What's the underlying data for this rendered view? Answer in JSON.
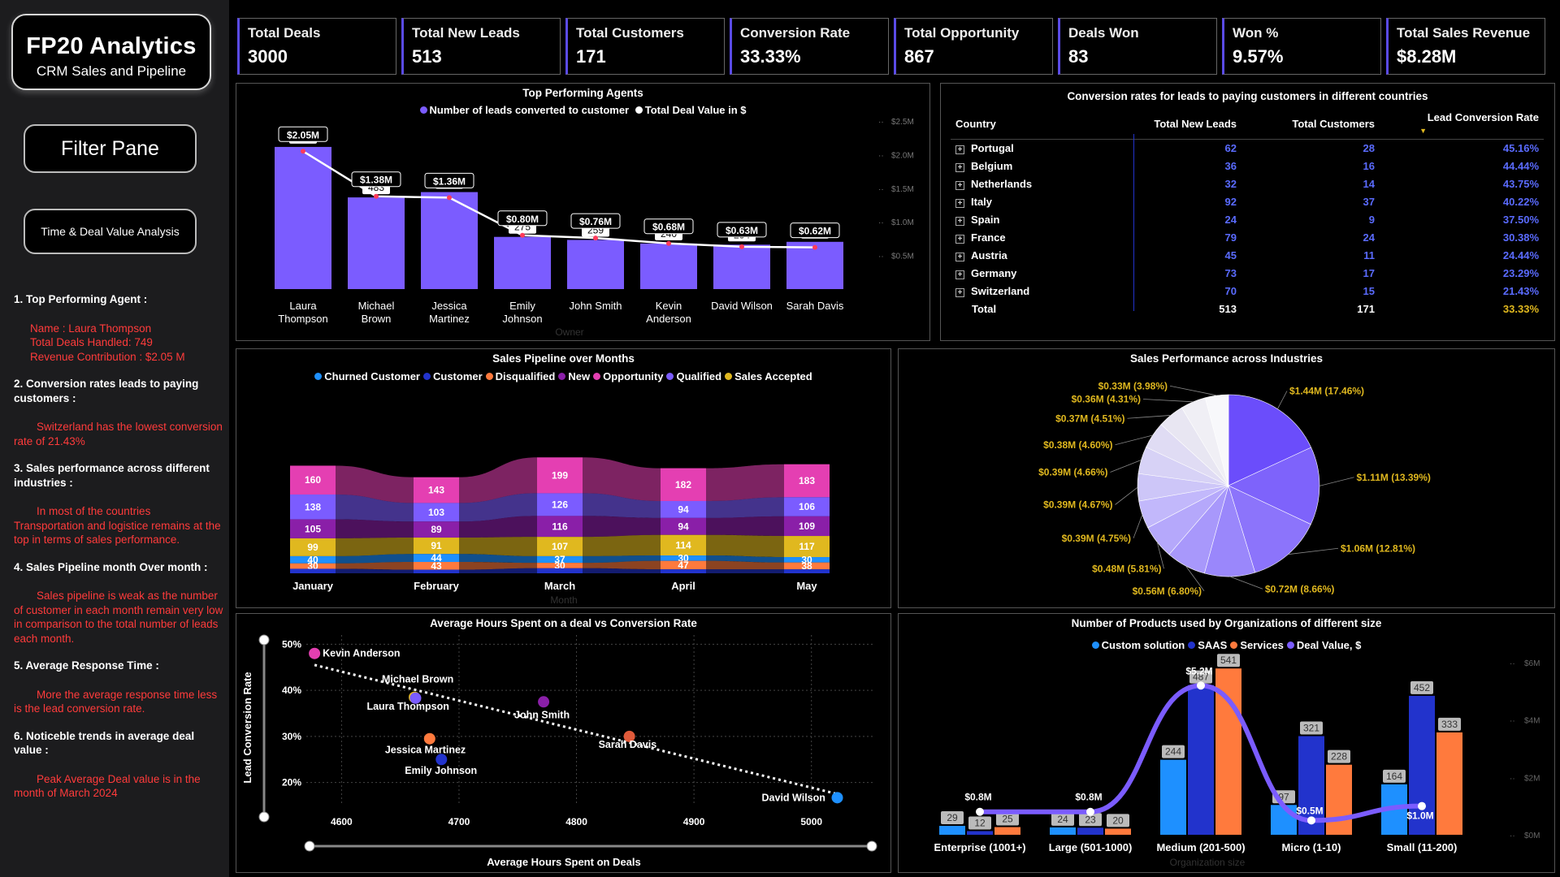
{
  "sidebar": {
    "title": "FP20 Analytics",
    "subtitle": "CRM Sales and Pipeline",
    "filter_label": "Filter Pane",
    "time_label": "Time & Deal Value Analysis",
    "insights": [
      {
        "heading": "1. Top Performing Agent :",
        "body": "Name : Laura Thompson\n  Total Deals Handled: 749\nRevenue Contribution : $2.05 M"
      },
      {
        "heading": "2. Conversion rates leads to paying customers :",
        "body": "Switzerland has the lowest conversion rate of 21.43%"
      },
      {
        "heading": "3. Sales performance across different industries :",
        "body": "In most of the countries Transportation and logistice remains at the top in terms of sales performance."
      },
      {
        "heading": "4. Sales Pipeline month Over month :",
        "body": "Sales pipeline is weak as the number of customer in each month remain very low in comparison to the total number of leads each month."
      },
      {
        "heading": "5. Average Response Time :",
        "body": "More the average response time less is the lead conversion rate."
      },
      {
        "heading": "6. Noticeble trends in average deal value :",
        "body": "Peak Average Deal value is in the month of March 2024"
      }
    ]
  },
  "kpis": [
    {
      "label": "Total Deals",
      "value": "3000"
    },
    {
      "label": "Total New Leads",
      "value": "513"
    },
    {
      "label": "Total Customers",
      "value": "171"
    },
    {
      "label": "Conversion Rate",
      "value": "33.33%"
    },
    {
      "label": "Total Opportunity",
      "value": "867"
    },
    {
      "label": "Deals Won",
      "value": "83"
    },
    {
      "label": "Won %",
      "value": "9.57%"
    },
    {
      "label": "Total Sales Revenue",
      "value": "$8.28M"
    }
  ],
  "colors": {
    "accent": "#7b5cff",
    "red_text": "#ff3b3b",
    "table_num": "#5a6bff"
  },
  "agents_chart": {
    "title": "Top Performing Agents",
    "legend": [
      "Number of leads converted to customer",
      "Total Deal Value in $"
    ],
    "x_label": "Owner",
    "y2_ticks": [
      "$2.5M",
      "$2.0M",
      "$1.5M",
      "$1.0M",
      "$0.5M"
    ]
  },
  "country_table": {
    "title": "Conversion rates for leads to paying customers in different countries",
    "headers": [
      "Country",
      "Total New Leads",
      "Total Customers",
      "Lead Conversion Rate"
    ],
    "rows": [
      [
        "Portugal",
        "62",
        "28",
        "45.16%"
      ],
      [
        "Belgium",
        "36",
        "16",
        "44.44%"
      ],
      [
        "Netherlands",
        "32",
        "14",
        "43.75%"
      ],
      [
        "Italy",
        "92",
        "37",
        "40.22%"
      ],
      [
        "Spain",
        "24",
        "9",
        "37.50%"
      ],
      [
        "France",
        "79",
        "24",
        "30.38%"
      ],
      [
        "Austria",
        "45",
        "11",
        "24.44%"
      ],
      [
        "Germany",
        "73",
        "17",
        "23.29%"
      ],
      [
        "Switzerland",
        "70",
        "15",
        "21.43%"
      ]
    ],
    "total": [
      "Total",
      "513",
      "171",
      "33.33%"
    ]
  },
  "pipeline_chart": {
    "title": "Sales Pipeline over Months",
    "x_label": "Month",
    "legend": [
      {
        "name": "Churned Customer",
        "color": "#1e90ff"
      },
      {
        "name": "Customer",
        "color": "#2233cc"
      },
      {
        "name": "Disqualified",
        "color": "#ff7a3d"
      },
      {
        "name": "New",
        "color": "#8a1fa8"
      },
      {
        "name": "Opportunity",
        "color": "#e43fb2"
      },
      {
        "name": "Qualified",
        "color": "#7b5cff"
      },
      {
        "name": "Sales Accepted",
        "color": "#e0b81f"
      }
    ]
  },
  "industry_chart": {
    "title": "Sales Performance across Industries"
  },
  "scatter_chart": {
    "title": "Average Hours Spent on a deal vs Conversion Rate",
    "xlabel": "Average Hours Spent on Deals",
    "ylabel": "Lead Conversion Rate"
  },
  "products_chart": {
    "title": "Number of Products used by Organizations of different size",
    "legend": [
      {
        "name": "Custom solution",
        "color": "#1e90ff"
      },
      {
        "name": "SAAS",
        "color": "#2233cc"
      },
      {
        "name": "Services",
        "color": "#ff7a3d"
      },
      {
        "name": "Deal Value, $",
        "color": "#7b5cff"
      }
    ],
    "x_label": "Organization size",
    "y2_ticks": [
      "$6M",
      "$4M",
      "$2M",
      "$0M"
    ]
  },
  "chart_data": [
    {
      "type": "bar",
      "id": "agents",
      "title": "Top Performing Agents",
      "categories": [
        "Laura Thompson",
        "Michael Brown",
        "Jessica Martinez",
        "Emily Johnson",
        "John Smith",
        "Kevin Anderson",
        "David Wilson",
        "Sarah Davis"
      ],
      "series": [
        {
          "name": "Number of leads converted to customer",
          "values": [
            749,
            483,
            511,
            275,
            259,
            240,
            234,
            249
          ]
        },
        {
          "name": "Total Deal Value in $",
          "values": [
            2.05,
            1.38,
            1.36,
            0.8,
            0.76,
            0.68,
            0.63,
            0.62
          ],
          "labels": [
            "$2.05M",
            "$1.38M",
            "$1.36M",
            "$0.80M",
            "$0.76M",
            "$0.68M",
            "$0.63M",
            "$0.62M"
          ]
        }
      ],
      "y2lim": [
        0,
        2.5
      ]
    },
    {
      "type": "area",
      "id": "pipeline",
      "title": "Sales Pipeline over Months",
      "categories": [
        "January",
        "February",
        "March",
        "April",
        "May"
      ],
      "series": [
        {
          "name": "Opportunity",
          "values": [
            160,
            143,
            199,
            182,
            183
          ]
        },
        {
          "name": "Qualified",
          "values": [
            138,
            103,
            126,
            94,
            106
          ]
        },
        {
          "name": "New",
          "values": [
            105,
            89,
            116,
            94,
            109
          ]
        },
        {
          "name": "Sales Accepted",
          "values": [
            99,
            91,
            107,
            114,
            117
          ]
        },
        {
          "name": "Churned Customer",
          "values": [
            40,
            44,
            37,
            30,
            30
          ]
        },
        {
          "name": "Disqualified",
          "values": [
            30,
            43,
            30,
            47,
            38
          ]
        },
        {
          "name": "Customer",
          "values": [
            25,
            20,
            28,
            22,
            22
          ]
        }
      ]
    },
    {
      "type": "pie",
      "id": "industries",
      "title": "Sales Performance across Industries",
      "labels": [
        "$1.44M (17.46%)",
        "$1.11M (13.39%)",
        "$1.06M (12.81%)",
        "$0.72M (8.66%)",
        "$0.56M (6.80%)",
        "$0.48M (5.81%)",
        "$0.39M (4.75%)",
        "$0.39M (4.67%)",
        "$0.39M (4.66%)",
        "$0.38M (4.60%)",
        "$0.37M (4.51%)",
        "$0.36M (4.31%)",
        "$0.33M (3.98%)"
      ],
      "values": [
        17.46,
        13.39,
        12.81,
        8.66,
        6.8,
        5.81,
        4.75,
        4.67,
        4.66,
        4.6,
        4.51,
        4.31,
        3.98
      ]
    },
    {
      "type": "scatter",
      "id": "hours",
      "title": "Average Hours Spent on a deal vs Conversion Rate",
      "xlabel": "Average Hours Spent on Deals",
      "ylabel": "Lead Conversion Rate",
      "xticks": [
        4600,
        4700,
        4800,
        4900,
        5000
      ],
      "yticks": [
        "50%",
        "40%",
        "30%",
        "20%"
      ],
      "xlim": [
        4570,
        5050
      ],
      "ylim": [
        0.15,
        0.52
      ],
      "points": [
        {
          "name": "Kevin Anderson",
          "x": 4577,
          "y": 0.48,
          "color": "#e43fb2"
        },
        {
          "name": "Michael Brown",
          "x": 4662,
          "y": 0.385,
          "color": "#e0b81f"
        },
        {
          "name": "Laura Thompson",
          "x": 4663,
          "y": 0.383,
          "color": "#7b5cff"
        },
        {
          "name": "John Smith",
          "x": 4772,
          "y": 0.375,
          "color": "#8a1fa8"
        },
        {
          "name": "Jessica Martinez",
          "x": 4675,
          "y": 0.295,
          "color": "#ff7a3d"
        },
        {
          "name": "Sarah Davis",
          "x": 4845,
          "y": 0.3,
          "color": "#e05a3a"
        },
        {
          "name": "Emily Johnson",
          "x": 4685,
          "y": 0.25,
          "color": "#2233cc"
        },
        {
          "name": "David Wilson",
          "x": 5022,
          "y": 0.167,
          "color": "#1e90ff"
        }
      ],
      "trend": [
        [
          4577,
          0.455
        ],
        [
          5022,
          0.175
        ]
      ]
    },
    {
      "type": "bar",
      "id": "products",
      "title": "Number of Products used by Organizations of different size",
      "categories": [
        "Enterprise (1001+)",
        "Large (501-1000)",
        "Medium (201-500)",
        "Micro (1-10)",
        "Small (11-200)"
      ],
      "series": [
        {
          "name": "Custom solution",
          "values": [
            29,
            24,
            244,
            97,
            164
          ]
        },
        {
          "name": "SAAS",
          "values": [
            12,
            23,
            487,
            321,
            452
          ]
        },
        {
          "name": "Services",
          "values": [
            25,
            20,
            541,
            228,
            333
          ]
        },
        {
          "name": "Deal Value, $",
          "values": [
            0.8,
            0.8,
            5.2,
            0.5,
            1.0
          ],
          "labels": [
            "$0.8M",
            "$0.8M",
            "$5.2M",
            "$0.5M",
            "$1.0M"
          ]
        }
      ],
      "ylim": [
        0,
        560
      ],
      "y2lim": [
        0,
        6
      ]
    }
  ]
}
